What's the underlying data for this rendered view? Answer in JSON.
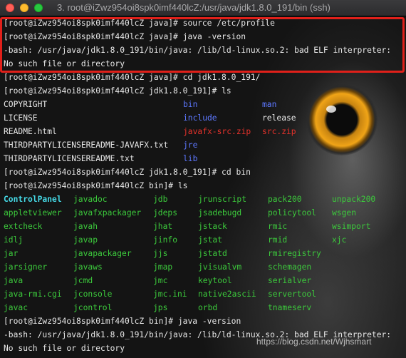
{
  "window": {
    "title": "3. root@iZwz954oi8spk0imf440lcZ:/usr/java/jdk1.8.0_191/bin (ssh)"
  },
  "colors": {
    "highlight_box": "#e0201a",
    "dir": "#5d78ff",
    "archive": "#e6322b",
    "exec": "#3cc93c",
    "exec_bold": "#45d9e6",
    "text": "#e8e8e8"
  },
  "terminal": {
    "lines": [
      "[root@iZwz954oi8spk0imf440lcZ java]# source /etc/profile",
      "[root@iZwz954oi8spk0imf440lcZ java]# java -version",
      "-bash: /usr/java/jdk1.8.0_191/bin/java: /lib/ld-linux.so.2: bad ELF interpreter:",
      "No such file or directory",
      "[root@iZwz954oi8spk0imf440lcZ java]# cd jdk1.8.0_191/",
      "[root@iZwz954oi8spk0imf440lcZ jdk1.8.0_191]# ls"
    ],
    "jdk_listing": [
      [
        "COPYRIGHT",
        "bin",
        "man"
      ],
      [
        "LICENSE",
        "include",
        "release"
      ],
      [
        "README.html",
        "javafx-src.zip",
        "src.zip"
      ],
      [
        "THIRDPARTYLICENSEREADME-JAVAFX.txt",
        "jre",
        ""
      ],
      [
        "THIRDPARTYLICENSEREADME.txt",
        "lib",
        ""
      ]
    ],
    "lines2": [
      "[root@iZwz954oi8spk0imf440lcZ jdk1.8.0_191]# cd bin",
      "[root@iZwz954oi8spk0imf440lcZ bin]# ls"
    ],
    "bin_listing": [
      [
        "ControlPanel",
        "javadoc",
        "jdb",
        "jrunscript",
        "pack200",
        "unpack200"
      ],
      [
        "appletviewer",
        "javafxpackager",
        "jdeps",
        "jsadebugd",
        "policytool",
        "wsgen"
      ],
      [
        "extcheck",
        "javah",
        "jhat",
        "jstack",
        "rmic",
        "wsimport"
      ],
      [
        "idlj",
        "javap",
        "jinfo",
        "jstat",
        "rmid",
        "xjc"
      ],
      [
        "jar",
        "javapackager",
        "jjs",
        "jstatd",
        "rmiregistry",
        ""
      ],
      [
        "jarsigner",
        "javaws",
        "jmap",
        "jvisualvm",
        "schemagen",
        ""
      ],
      [
        "java",
        "jcmd",
        "jmc",
        "keytool",
        "serialver",
        ""
      ],
      [
        "java-rmi.cgi",
        "jconsole",
        "jmc.ini",
        "native2ascii",
        "servertool",
        ""
      ],
      [
        "javac",
        "jcontrol",
        "jps",
        "orbd",
        "tnameserv",
        ""
      ]
    ],
    "lines3": [
      "[root@iZwz954oi8spk0imf440lcZ bin]# java -version",
      "-bash: /usr/java/jdk1.8.0_191/bin/java: /lib/ld-linux.so.2: bad ELF interpreter:",
      "No such file or directory"
    ]
  },
  "watermark": "https://blog.csdn.net/Wjhsmart"
}
